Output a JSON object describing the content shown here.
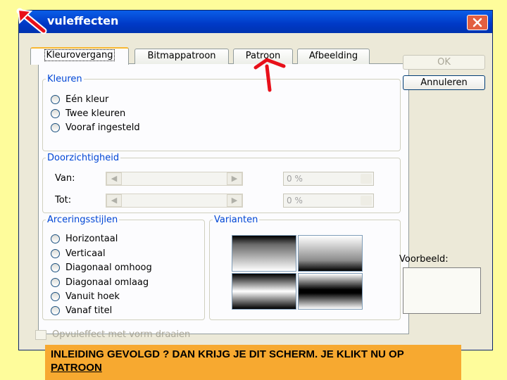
{
  "dialog": {
    "title": "vuleffecten",
    "tabs": [
      {
        "label": "Kleurovergang",
        "active": true
      },
      {
        "label": "Bitmappatroon"
      },
      {
        "label": "Patroon"
      },
      {
        "label": "Afbeelding"
      }
    ],
    "kleuren": {
      "legend": "Kleuren",
      "options": [
        "Eén kleur",
        "Twee kleuren",
        "Vooraf ingesteld"
      ]
    },
    "doorzichtigheid": {
      "legend": "Doorzichtigheid",
      "van_label": "Van:",
      "tot_label": "Tot:",
      "van_value": "0 %",
      "tot_value": "0 %"
    },
    "arcering": {
      "legend": "Arceringsstijlen",
      "options": [
        "Horizontaal",
        "Verticaal",
        "Diagonaal omhoog",
        "Diagonaal omlaag",
        "Vanuit hoek",
        "Vanaf titel"
      ]
    },
    "varianten": {
      "legend": "Varianten"
    },
    "buttons": {
      "ok": "OK",
      "cancel": "Annuleren"
    },
    "preview_label": "Voorbeeld:",
    "rotate_label": "Opvuleffect met vorm draaien"
  },
  "caption": {
    "text": "INLEIDING GEVOLGD ? DAN KRIJG JE DIT SCHERM. JE KLIKT NU OP",
    "link": "PATROON"
  },
  "colors": {
    "annotation": "#e8101a",
    "titlebar": "#0039c6",
    "caption_bg": "#f7a930",
    "page_bg": "#fefc9b"
  }
}
